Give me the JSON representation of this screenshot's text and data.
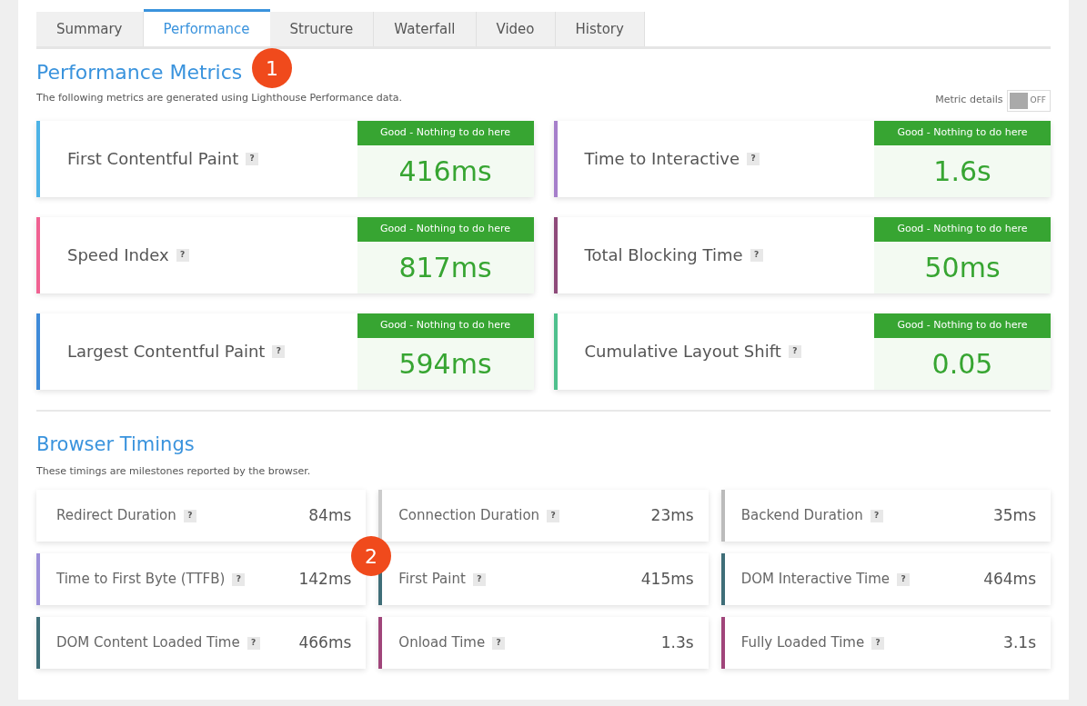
{
  "tabs": [
    {
      "label": "Summary",
      "selected": false
    },
    {
      "label": "Performance",
      "selected": true
    },
    {
      "label": "Structure",
      "selected": false
    },
    {
      "label": "Waterfall",
      "selected": false
    },
    {
      "label": "Video",
      "selected": false
    },
    {
      "label": "History",
      "selected": false
    }
  ],
  "performance_metrics": {
    "title": "Performance Metrics",
    "description": "The following metrics are generated using Lighthouse Performance data.",
    "toggle": {
      "label": "Metric details",
      "state_text": "OFF",
      "on": false
    },
    "metrics": [
      {
        "name": "First Contentful Paint",
        "help": "?",
        "verdict": "Good - Nothing to do here",
        "value": "416ms",
        "color": "#4db3e6"
      },
      {
        "name": "Time to Interactive",
        "help": "?",
        "verdict": "Good - Nothing to do here",
        "value": "1.6s",
        "color": "#a67fcb"
      },
      {
        "name": "Speed Index",
        "help": "?",
        "verdict": "Good - Nothing to do here",
        "value": "817ms",
        "color": "#f06292"
      },
      {
        "name": "Total Blocking Time",
        "help": "?",
        "verdict": "Good - Nothing to do here",
        "value": "50ms",
        "color": "#8e4a7a"
      },
      {
        "name": "Largest Contentful Paint",
        "help": "?",
        "verdict": "Good - Nothing to do here",
        "value": "594ms",
        "color": "#3f8ad8"
      },
      {
        "name": "Cumulative Layout Shift",
        "help": "?",
        "verdict": "Good - Nothing to do here",
        "value": "0.05",
        "color": "#4fc08d"
      }
    ]
  },
  "browser_timings": {
    "title": "Browser Timings",
    "description": "These timings are milestones reported by the browser.",
    "items": [
      {
        "name": "Redirect Duration",
        "help": "?",
        "value": "84ms",
        "color": "#ffffff"
      },
      {
        "name": "Connection Duration",
        "help": "?",
        "value": "23ms",
        "color": "#cccccc"
      },
      {
        "name": "Backend Duration",
        "help": "?",
        "value": "35ms",
        "color": "#bbbbbb"
      },
      {
        "name": "Time to First Byte (TTFB)",
        "help": "?",
        "value": "142ms",
        "color": "#9b8fd8"
      },
      {
        "name": "First Paint",
        "help": "?",
        "value": "415ms",
        "color": "#3f6e78"
      },
      {
        "name": "DOM Interactive Time",
        "help": "?",
        "value": "464ms",
        "color": "#3f6e78"
      },
      {
        "name": "DOM Content Loaded Time",
        "help": "?",
        "value": "466ms",
        "color": "#3f6e78"
      },
      {
        "name": "Onload Time",
        "help": "?",
        "value": "1.3s",
        "color": "#a0457a"
      },
      {
        "name": "Fully Loaded Time",
        "help": "?",
        "value": "3.1s",
        "color": "#a0457a"
      }
    ]
  },
  "callouts": [
    {
      "label": "1"
    },
    {
      "label": "2"
    }
  ]
}
